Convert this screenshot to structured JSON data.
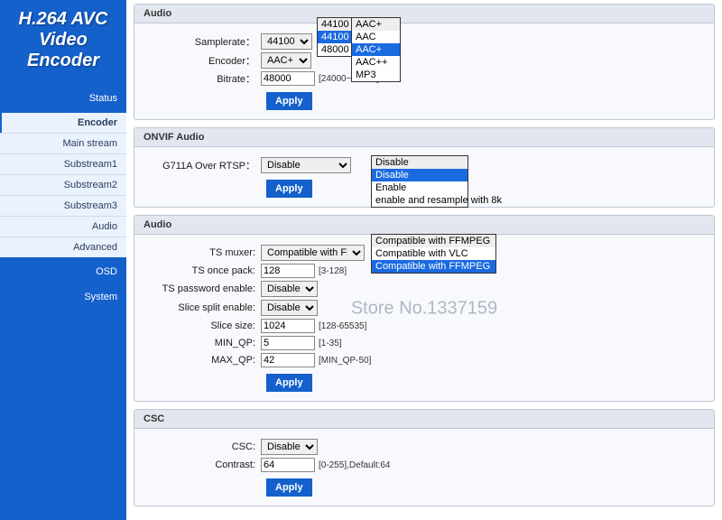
{
  "logo": "H.264 AVC Video Encoder",
  "nav": {
    "sec1": "Status",
    "sec2": "Encoder",
    "items": [
      "Main stream",
      "Substream1",
      "Substream2",
      "Substream3",
      "Audio",
      "Advanced"
    ],
    "sec3": "OSD",
    "sec4": "System"
  },
  "audio": {
    "title": "Audio",
    "samplerate_label": "Samplerate：",
    "samplerate_value": "44100",
    "samplerate_opts": [
      "44100",
      "44100",
      "48000"
    ],
    "encoder_label": "Encoder：",
    "encoder_value": "AAC+",
    "encoder_opts": [
      "AAC+",
      "AAC",
      "AAC+",
      "AAC++",
      "MP3"
    ],
    "bitrate_label": "Bitrate：",
    "bitrate_value": "48000",
    "bitrate_hint": "[24000~48000]",
    "apply": "Apply"
  },
  "onvif": {
    "title": "ONVIF Audio",
    "g711_label": "G711A Over RTSP：",
    "g711_value": "Disable",
    "opts": [
      "Disable",
      "Disable",
      "Enable",
      "enable and resample with 8k"
    ],
    "apply": "Apply"
  },
  "ts": {
    "title": "Audio",
    "muxer_label": "TS muxer:",
    "muxer_value": "Compatible with FFMPEG",
    "muxer_opts": [
      "Compatible with FFMPEG",
      "Compatible with VLC",
      "Compatible with FFMPEG"
    ],
    "once_label": "TS once pack:",
    "once_value": "128",
    "once_hint": "[3-128]",
    "pass_label": "TS password enable:",
    "pass_value": "Disable",
    "slice_en_label": "Slice split enable:",
    "slice_en_value": "Disable",
    "slice_size_label": "Slice size:",
    "slice_size_value": "1024",
    "slice_size_hint": "[128-65535]",
    "min_qp_label": "MIN_QP:",
    "min_qp_value": "5",
    "min_qp_hint": "[1-35]",
    "max_qp_label": "MAX_QP:",
    "max_qp_value": "42",
    "max_qp_hint": "[MIN_QP-50]",
    "apply": "Apply"
  },
  "csc": {
    "title": "CSC",
    "csc_label": "CSC:",
    "csc_value": "Disable",
    "contrast_label": "Contrast:",
    "contrast_value": "64",
    "contrast_hint": "[0-255],Default:64",
    "apply": "Apply"
  },
  "watermark": "Store No.1337159"
}
